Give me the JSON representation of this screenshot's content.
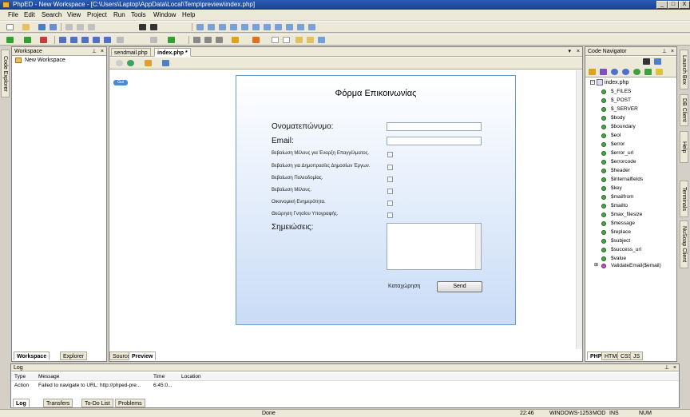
{
  "window": {
    "title": "PhpED - New Workspace - [C:\\Users\\Laptop\\AppData\\Local\\Temp\\preview\\index.php]",
    "controls": [
      "_",
      "□",
      "X"
    ]
  },
  "menu": [
    "File",
    "Edit",
    "Search",
    "View",
    "Project",
    "Run",
    "Tools",
    "Window",
    "Help"
  ],
  "left_side_tab": "Code Explorer",
  "workspace": {
    "title": "Workspace",
    "root": "New Workspace",
    "tabs": [
      "Workspace",
      "Explorer"
    ]
  },
  "editor": {
    "tabs": [
      "sendmail.php",
      "index.php *"
    ],
    "bottom_tabs": [
      "Source",
      "Preview"
    ],
    "preview_badge": "Gui",
    "form": {
      "title": "Φόρμα Επικοινωνίας",
      "fields": [
        {
          "label": "Ονοματεπώνυμο:"
        },
        {
          "label": "Email:"
        }
      ],
      "checkboxes": [
        "Βεβαίωση Μέλους για Έναρξη Επαγγέλματος.",
        "Βεβαίωση για Δημοπρασίες Δημοσίων Έργων.",
        "Βεβαίωση Πολεοδομίας.",
        "Βεβαίωση Μέλους.",
        "Οικονομική Ενημερότητα.",
        "Θεώρηση Γνησίου Υπογραφής."
      ],
      "notes_label": "Σημειώσεις:",
      "submit_caption": "Καταχώρηση",
      "send_button": "Send"
    }
  },
  "code_navigator": {
    "title": "Code Navigator",
    "file": "index.php",
    "items": [
      "$_FILES",
      "$_POST",
      "$_SERVER",
      "$body",
      "$boundary",
      "$eol",
      "$error",
      "$error_url",
      "$errorcode",
      "$header",
      "$internalfields",
      "$key",
      "$mailfrom",
      "$mailto",
      "$max_filesize",
      "$message",
      "$replace",
      "$subject",
      "$success_url",
      "$value"
    ],
    "function_item": "ValidateEmail($email)",
    "tabs": [
      "PHP",
      "HTML",
      "CSS",
      "JS"
    ]
  },
  "right_side_tabs": [
    "Launch Box",
    "DB Client",
    "Help",
    "Terminals",
    "NuSoap Client"
  ],
  "log": {
    "title": "Log",
    "columns": [
      "Type",
      "Message",
      "Time",
      "Location"
    ],
    "rows": [
      {
        "type": "Action",
        "message": "Failed to navigate to URL: http://phped-pre...",
        "time": "6:45:0...",
        "location": ""
      }
    ],
    "tabs": [
      "Log",
      "Transfers",
      "To-Do List",
      "Problems"
    ]
  },
  "status": {
    "text": "Done",
    "time": "22:46",
    "encoding": "WINDOWS-1253",
    "mod": "MOD",
    "ins": "INS",
    "num": "NUM"
  }
}
